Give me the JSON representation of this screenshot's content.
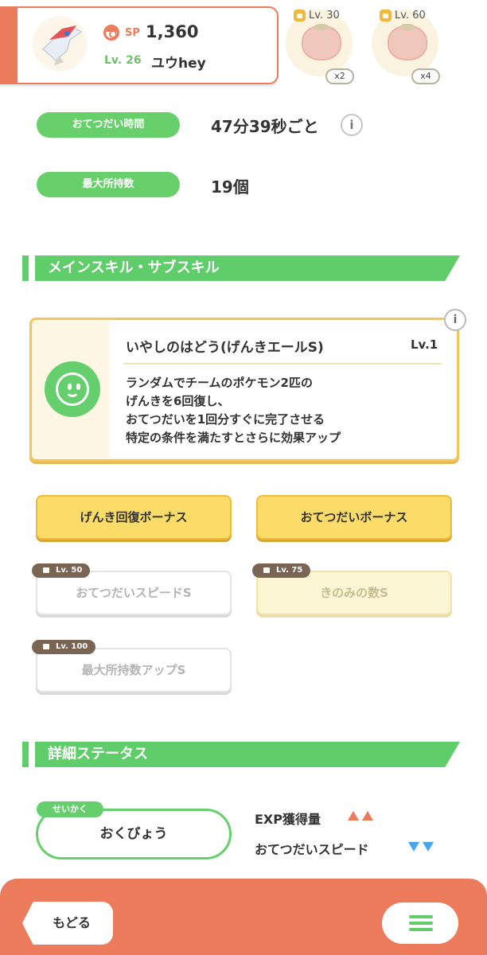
{
  "profile": {
    "sp_label": "SP",
    "sp_value": "1,360",
    "level": "Lv. 26",
    "name": "ユウhey"
  },
  "ingredients": [
    {
      "level": "Lv. 30",
      "count": "x2",
      "icon": "tomato-icon"
    },
    {
      "level": "Lv. 60",
      "count": "x4",
      "icon": "tomato-icon"
    }
  ],
  "stats": {
    "help_time_label": "おてつだい時間",
    "help_time_value": "47分39秒ごと",
    "max_carry_label": "最大所持数",
    "max_carry_value": "19個"
  },
  "sections": {
    "skills_title": "メインスキル・サブスキル",
    "details_title": "詳細ステータス"
  },
  "main_skill": {
    "name": "いやしのはどう(げんきエールS)",
    "level": "Lv.1",
    "desc_lines": [
      "ランダムでチームのポケモン2匹の",
      "げんきを6回復し、",
      "おてつだいを1回分すぐに完了させる",
      "特定の条件を満たすとさらに効果アップ"
    ],
    "icon": "smile-face-icon"
  },
  "sub_skills": [
    {
      "label": "げんき回復ボーナス",
      "lock": ""
    },
    {
      "label": "おてつだいボーナス",
      "lock": ""
    },
    {
      "label": "おてつだいスピードS",
      "lock": "Lv. 50"
    },
    {
      "label": "きのみの数S",
      "lock": "Lv. 75"
    },
    {
      "label": "最大所持数アップS",
      "lock": "Lv. 100"
    }
  ],
  "nature": {
    "tag": "せいかく",
    "value": "おくびょう",
    "effects": [
      {
        "label": "EXP獲得量",
        "direction": "up",
        "color": "#ec7b5c"
      },
      {
        "label": "おてつだいスピード",
        "direction": "down",
        "color": "#4aa5ec"
      }
    ]
  },
  "footer": {
    "back_label": "もどる"
  },
  "colors": {
    "accent_orange": "#ec7b5c",
    "accent_green": "#5fce6a",
    "gold": "#fbdc68"
  }
}
